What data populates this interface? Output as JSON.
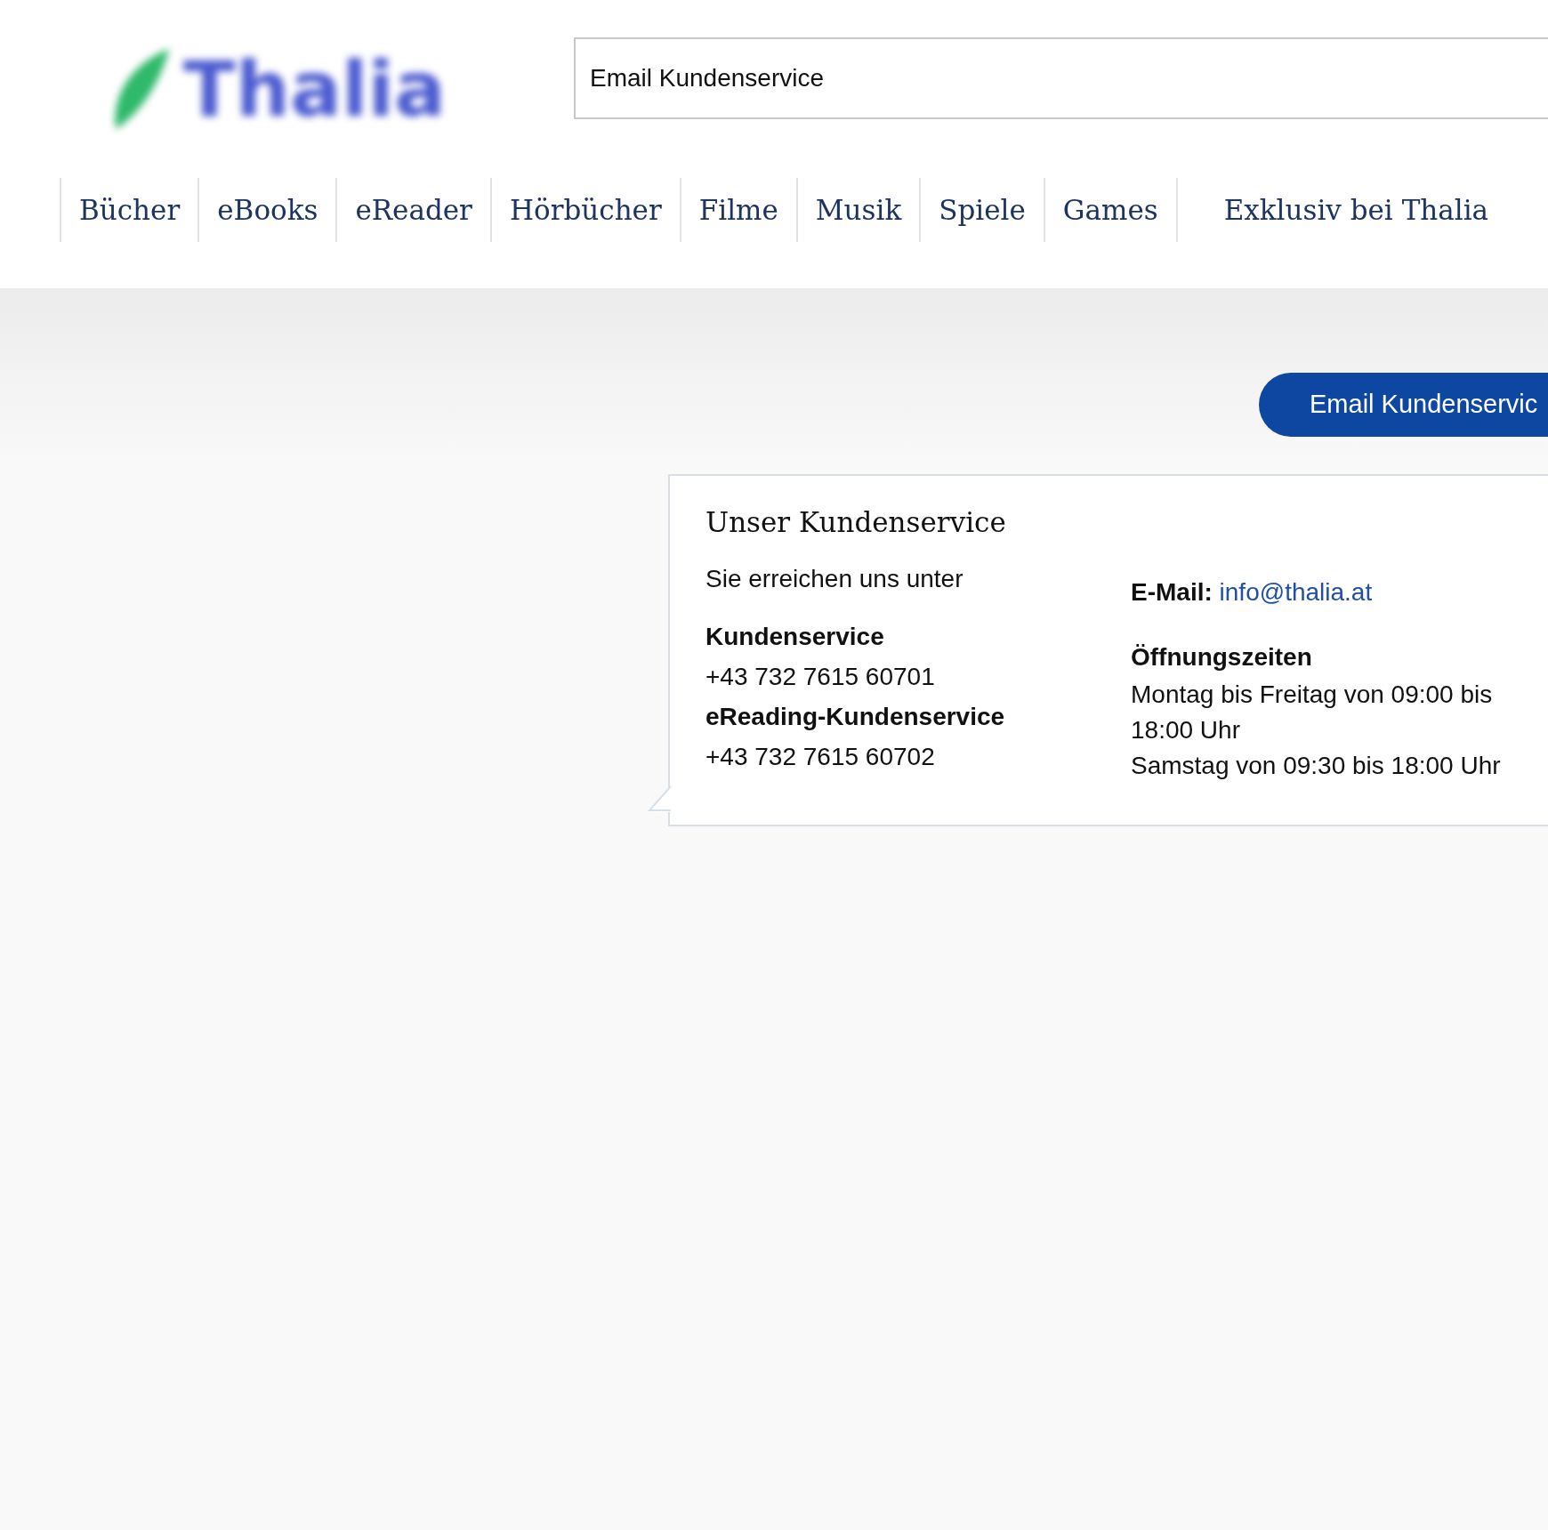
{
  "logo": {
    "text": "Thalia"
  },
  "search": {
    "value": "Email Kundenservice"
  },
  "nav": [
    {
      "label": "Bücher"
    },
    {
      "label": "eBooks"
    },
    {
      "label": "eReader"
    },
    {
      "label": "Hörbücher"
    },
    {
      "label": "Filme"
    },
    {
      "label": "Musik"
    },
    {
      "label": "Spiele"
    },
    {
      "label": "Games"
    },
    {
      "label": "Exklusiv bei Thalia"
    }
  ],
  "button": {
    "label": "Email Kundenservic"
  },
  "card": {
    "title": "Unser Kundenservice",
    "intro": "Sie erreichen uns unter",
    "contacts": [
      {
        "label": "Kundenservice",
        "value": "+43 732 7615 60701"
      },
      {
        "label": "eReading-Kundenservice",
        "value": "+43 732 7615 60702"
      }
    ],
    "email": {
      "label": "E-Mail:",
      "link": "info@thalia.at"
    },
    "hours": {
      "title": "Öffnungszeiten",
      "lines": [
        "Montag bis Freitag von 09:00 bis 18:00 Uhr",
        "Samstag von 09:30 bis 18:00 Uhr"
      ]
    }
  }
}
